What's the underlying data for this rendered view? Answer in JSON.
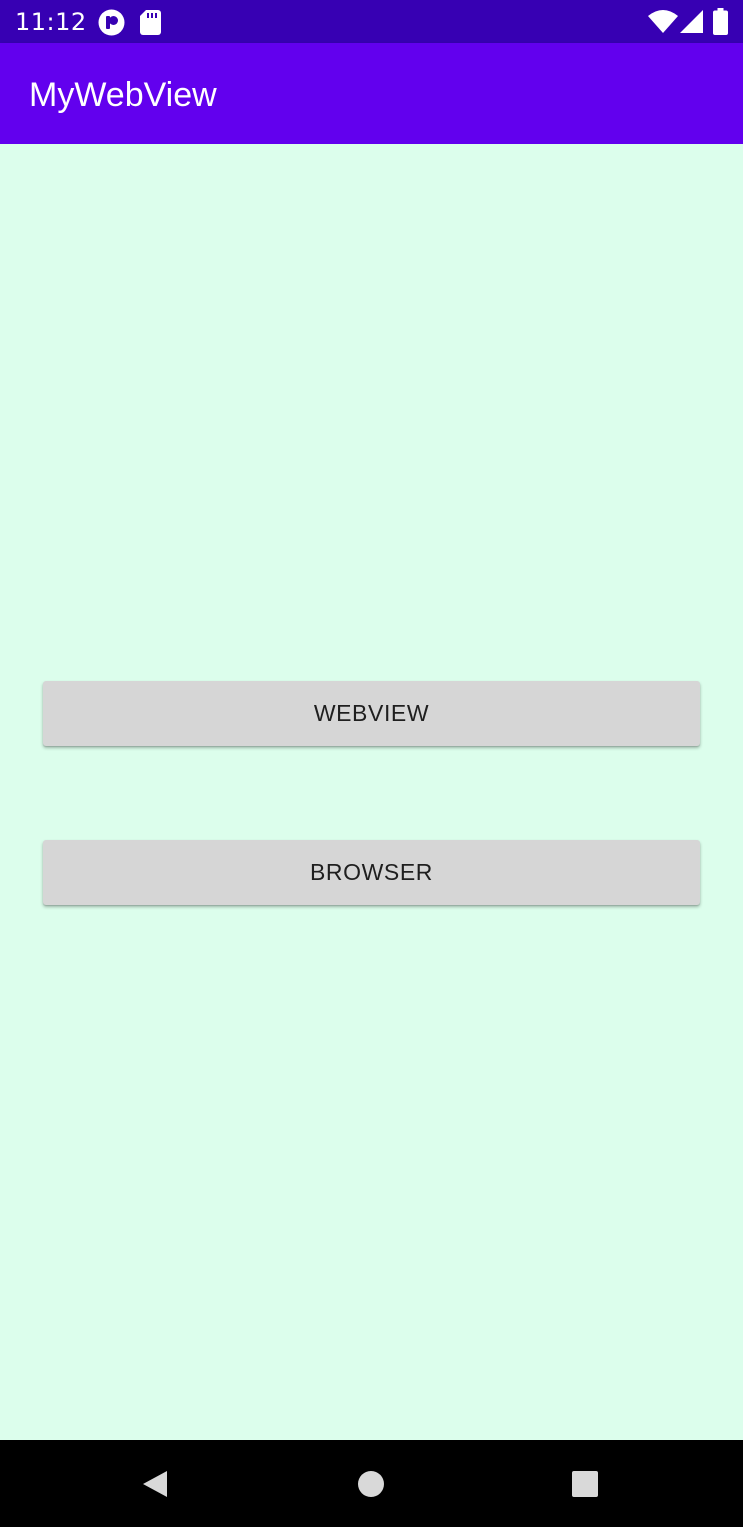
{
  "status_bar": {
    "time": "11:12",
    "left_icons": [
      "app-notification-icon",
      "sd-card-icon"
    ],
    "right_icons": [
      "wifi-icon",
      "cell-signal-icon",
      "battery-icon"
    ],
    "background": "#3700b3"
  },
  "app_bar": {
    "title": "MyWebView",
    "background": "#6200ee"
  },
  "main": {
    "background": "#dcfeec",
    "buttons": [
      {
        "label": "WEBVIEW"
      },
      {
        "label": "BROWSER"
      }
    ]
  },
  "nav_bar": {
    "icons": [
      "back-icon",
      "home-icon",
      "recents-icon"
    ],
    "background": "#000000"
  }
}
